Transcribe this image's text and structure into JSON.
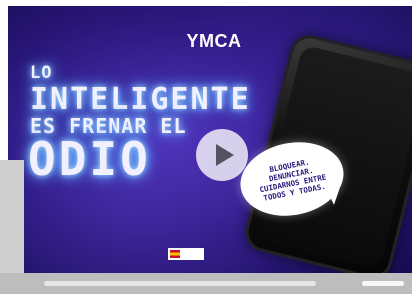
{
  "video": {
    "logo_text": "YMCA",
    "headline": [
      "LO",
      "INTELIGENTE",
      "ES FRENAR EL",
      "ODIO"
    ],
    "bubble_lines": [
      "BLOQUEAR.",
      "DENUNCIAR.",
      "CUIDARNOS ENTRE",
      "TODOS Y TODAS."
    ],
    "funding_text": "",
    "play_icon": "play-icon"
  },
  "player": {
    "progress": 0.0,
    "volume": 1.0
  },
  "colors": {
    "background_start": "#4b2fb3",
    "background_end": "#160a4c",
    "neon_glow": "#6fb7ff",
    "bubble_text": "#2b1a7a"
  }
}
